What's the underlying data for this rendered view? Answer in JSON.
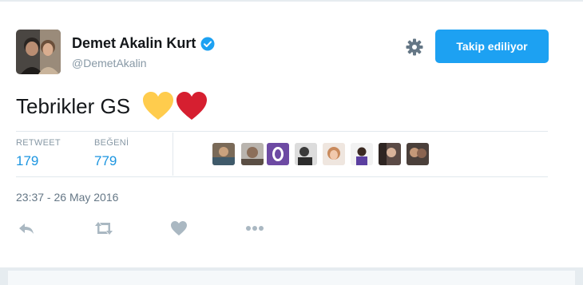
{
  "tweet": {
    "user": {
      "name": "Demet Akalin Kurt",
      "handle": "@DemetAkalin",
      "verified": true
    },
    "follow_button_label": "Takip ediliyor",
    "text": "Tebrikler GS",
    "emoji": [
      "yellow-heart",
      "red-heart"
    ],
    "stats": [
      {
        "label": "RETWEET",
        "value": "179"
      },
      {
        "label": "BEĞENİ",
        "value": "779"
      }
    ],
    "likers_count_shown": 8,
    "timestamp": "23:37 - 26 May 2016",
    "actions": [
      "reply-icon",
      "retweet-icon",
      "like-icon",
      "more-icon"
    ]
  },
  "colors": {
    "accent": "#1da1f2",
    "count": "#1b95e0",
    "muted": "#8899a6",
    "yellow_heart": "#ffcc4d",
    "red_heart": "#d61f30"
  }
}
